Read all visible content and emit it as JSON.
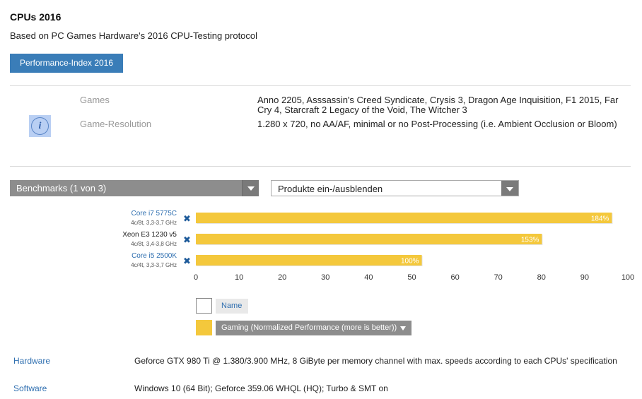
{
  "header": {
    "title": "CPUs 2016",
    "subtitle": "Based on PC Games Hardware's 2016 CPU-Testing protocol",
    "tab_label": "Performance-Index 2016"
  },
  "info": {
    "icon": "info-icon",
    "icon_glyph": "i",
    "games_label": "Games",
    "games_value": "Anno 2205, Asssassin's Creed Syndicate, Crysis 3, Dragon Age Inquisition, F1 2015, Far Cry 4, Starcraft 2 Legacy of the Void, The Witcher 3",
    "resolution_label": "Game-Resolution",
    "resolution_value": "1.280 x 720, no AA/AF, minimal or no Post-Processing (i.e. Ambient Occlusion or Bloom)"
  },
  "controls": {
    "benchmarks_dropdown": "Benchmarks (1 von 3)",
    "products_dropdown": "Produkte ein-/ausblenden"
  },
  "chart_data": {
    "type": "bar",
    "orientation": "horizontal",
    "categories": [
      "Core i7 5775C",
      "Xeon E3 1230 v5",
      "Core i5 2500K"
    ],
    "category_specs": [
      "4c/8t, 3,3-3,7 GHz",
      "4c/8t, 3,4-3,8 GHz",
      "4c/4t, 3,3-3,7 GHz"
    ],
    "category_links": [
      true,
      false,
      true
    ],
    "series": [
      {
        "name": "Gaming (Normalized Performance (more is better))",
        "values": [
          96.3,
          80.1,
          52.3
        ],
        "labels": [
          "184%",
          "153%",
          "100%"
        ],
        "color": "#f4c83c"
      }
    ],
    "xlim": [
      0,
      100
    ],
    "xticks": [
      0,
      10,
      20,
      30,
      40,
      50,
      60,
      70,
      80,
      90,
      100
    ],
    "grid": false,
    "legend": "bottom"
  },
  "legend": {
    "name_label": "Name",
    "series_label": "Gaming (Normalized Performance (more is better))"
  },
  "remove_icon": "close-icon",
  "remove_glyph": "✖",
  "footer": {
    "hardware_label": "Hardware",
    "hardware_value": "Geforce GTX 980 Ti @ 1.380/3.900 MHz, 8 GiByte per memory channel with max. speeds according to each CPUs' specification",
    "software_label": "Software",
    "software_value": "Windows 10 (64 Bit); Geforce 359.06 WHQL (HQ); Turbo & SMT on"
  },
  "colors": {
    "accent": "#3a7db8",
    "bar": "#f4c83c",
    "link": "#2f6fb0"
  }
}
